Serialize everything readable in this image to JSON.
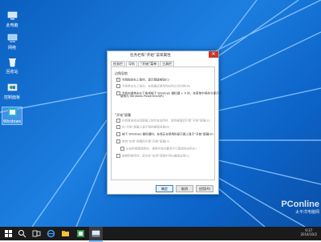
{
  "desktop_icons": [
    {
      "label": "此电脑"
    },
    {
      "label": "网络"
    },
    {
      "label": "回收站"
    },
    {
      "label": "控制面板"
    },
    {
      "label": "Windows"
    }
  ],
  "dialog": {
    "title": "任务栏和“开始”菜单属性",
    "close_glyph": "✕",
    "tabs": [
      "任务栏",
      "导航",
      "“开始”菜单",
      "工具栏"
    ],
    "active_tab": 1,
    "section1": "边角导航",
    "section1_options": [
      {
        "label": "当我指向右上角时，显示超级按钮(C)",
        "checked": true,
        "dim": false
      },
      {
        "label": "当我单击左上角时，在我最近使用的应用之间切换(W)",
        "checked": false,
        "dim": true
      },
      {
        "label": "当我右键单击左下角或按下 Windows 徽标键 + X 时，在菜单中将命令提示符",
        "checked": false,
        "dim": false
      }
    ],
    "section1_option_cont": "替换为 Windows PowerShell(R)",
    "section2": "“开始”屏幕",
    "section2_options": [
      {
        "label": "在我登录或关闭屏幕上的所有应用时，转到桌面而不是“开始”屏幕(G)",
        "checked": false,
        "dim": true
      },
      {
        "label": "在“开始”屏幕上显示我的桌面背景(B)",
        "checked": false,
        "dim": true
      },
      {
        "label": "按下 Windows 徽标键时，在我正在使用的显示屏上显示“开始”屏幕(H)",
        "checked": false,
        "dim": false
      },
      {
        "label": "转到“应用”视图而不是“开始”屏幕(V)",
        "checked": false,
        "dim": true
      },
      {
        "label": "从应用视图搜索时，搜索所有位置而不只是我的应用(E)",
        "checked": false,
        "dim": true,
        "indent": true
      },
      {
        "label": "按类别排序时，首先在“应用”视图中列出桌面应用(L)",
        "checked": false,
        "dim": true
      }
    ],
    "buttons": {
      "ok": "确定",
      "cancel": "取消",
      "apply": "应用(A)"
    }
  },
  "taskbar": {
    "start_icon": "windows-logo-icon",
    "apps": [
      "search-icon",
      "task-view-icon",
      "internet-explorer-icon",
      "file-explorer-icon",
      "store-icon",
      "taskbar-properties-icon"
    ],
    "time": "9:37",
    "date": "2014/10/2"
  },
  "watermark": {
    "brand": "PConline",
    "sub": "太平洋电脑网"
  },
  "colors": {
    "accent": "#1d7fe0",
    "close": "#c7392b",
    "taskbar": "#1b1b1b"
  }
}
